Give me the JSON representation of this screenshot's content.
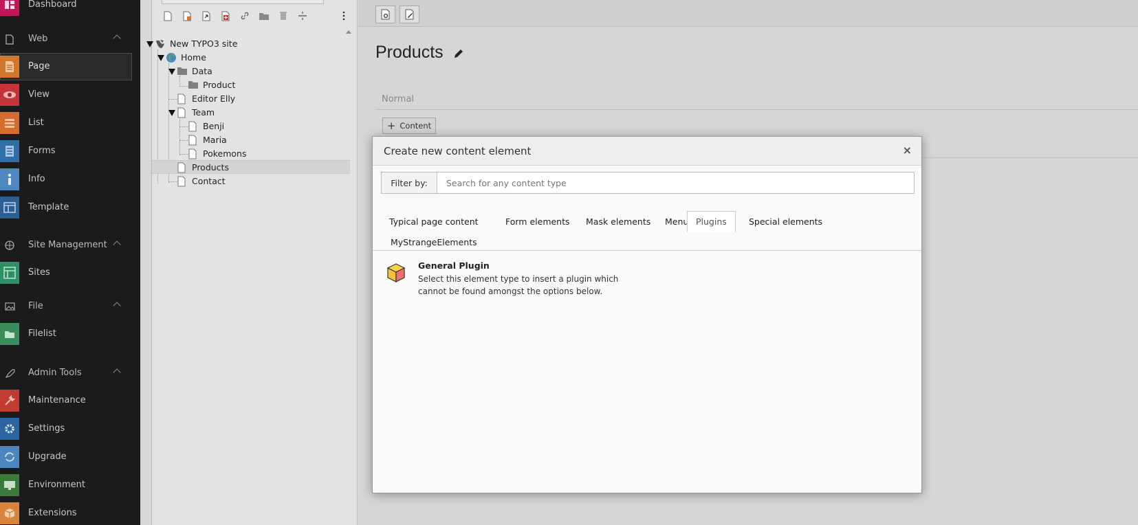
{
  "module_menu": {
    "dashboard": "Dashboard",
    "groups": {
      "web": "Web",
      "site_management": "Site Management",
      "file": "File",
      "admin_tools": "Admin Tools"
    },
    "items": {
      "page": "Page",
      "view": "View",
      "list": "List",
      "forms": "Forms",
      "info": "Info",
      "template": "Template",
      "sites": "Sites",
      "filelist": "Filelist",
      "maintenance": "Maintenance",
      "settings": "Settings",
      "upgrade": "Upgrade",
      "environment": "Environment",
      "extensions": "Extensions"
    },
    "colors": {
      "dashboard": "#c2185b",
      "page": "#d3782b",
      "view": "#c6333b",
      "list": "#d36c2c",
      "forms": "#2f6fa8",
      "info": "#4e88bf",
      "template": "#2d5e91",
      "sites": "#2f8f67",
      "filelist": "#3a8e5b",
      "maintenance": "#c13b32",
      "settings": "#2a64a1",
      "upgrade": "#4b86c1",
      "environment": "#3b7a3b",
      "extensions": "#d9843a"
    }
  },
  "page_tree": {
    "nodes": {
      "root": "New TYPO3 site",
      "home": "Home",
      "data": "Data",
      "product": "Product",
      "editor_elly": "Editor Elly",
      "team": "Team",
      "benji": "Benji",
      "maria": "Maria",
      "pokemons": "Pokemons",
      "products": "Products",
      "contact": "Contact"
    }
  },
  "content": {
    "page_title": "Products",
    "column_name": "Normal",
    "add_content_label": "Content"
  },
  "modal": {
    "title": "Create new content element",
    "close": "×",
    "filter_label": "Filter by:",
    "filter_placeholder": "Search for any content type",
    "tabs": {
      "typical": "Typical page content",
      "form": "Form elements",
      "mask": "Mask elements",
      "menu": "Menu",
      "plugins": "Plugins",
      "special": "Special elements",
      "strange": "MyStrangeElements"
    },
    "active_tab": "Plugins",
    "element": {
      "title": "General Plugin",
      "description": "Select this element type to insert a plugin which cannot be found amongst the options below."
    }
  }
}
